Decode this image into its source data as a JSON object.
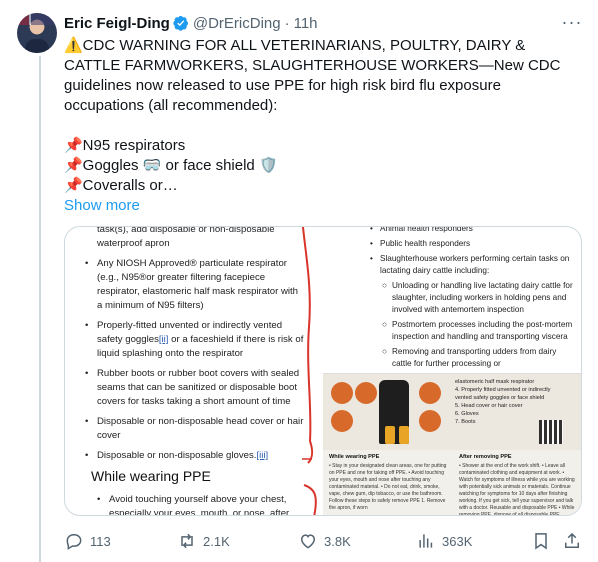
{
  "tweet": {
    "author_name": "Eric Feigl-Ding",
    "handle": "@DrEricDing",
    "separator": "·",
    "time": "11h",
    "more_label": "···",
    "text_para1": "⚠️CDC WARNING FOR ALL VETERINARIANS, POULTRY, DAIRY & CATTLE FARMWORKERS, SLAUGHTERHOUSE WORKERS—New CDC guidelines now released to use PPE for high risk bird flu exposure occupations (all recommended):",
    "line1": "📌N95 respirators",
    "line2": "📌Goggles 🥽 or face shield 🛡️",
    "line3": "📌Coveralls or…",
    "show_more": "Show more"
  },
  "media": {
    "left_top_fragment": "task(s), add disposable or non-disposable waterproof apron",
    "left_items": [
      "Any NIOSH Approved® particulate respirator (e.g., N95®or greater filtering facepiece respirator, elastomeric half mask respirator with a minimum of N95 filters)",
      "Properly-fitted unvented or indirectly vented safety goggles",
      "Rubber boots or rubber boot covers with sealed seams that can be sanitized or disposable boot covers for tasks taking a short amount of time",
      "Disposable or non-disposable head cover or hair cover",
      "Disposable or non-disposable gloves."
    ],
    "goggles_ref": "[ii]",
    "goggles_tail": " or a faceshield if there is risk of liquid splashing onto the respirator",
    "gloves_ref": "[iii]",
    "heading": "While wearing PPE",
    "wearing_item": "Avoid touching yourself above your chest, especially your eyes, mouth, or nose, after",
    "right_top_fragment": "Animal health responders",
    "right_items": [
      "Public health responders",
      "Slaughterhouse workers performing certain tasks on lactating dairy cattle including:"
    ],
    "right_sub": [
      "Unloading or handling live lactating dairy cattle for slaughter, including workers in holding pens and involved with antemortem inspection",
      "Postmortem processes including the post-mortem inspection and handling and transporting viscera",
      "Removing and transporting udders from dairy cattle for further processing or"
    ],
    "poster_list": [
      "elastomeric half mask respirator",
      "4. Properly fitted unvented or indirectly vented safety goggles or face shield",
      "5. Head cover or hair cover",
      "6. Gloves",
      "7. Boots"
    ],
    "poster_wearing_title": "While wearing PPE",
    "poster_wearing_text": "• Stay in your designated clean areas, one for putting on PPE and one for taking off PPE. • Avoid touching your eyes, mouth and nose after touching any contaminated material. • Do not eat, drink, smoke, vape, chew gum, dip tobacco, or use the bathroom. Follow these steps to safely remove PPE 1. Remove the apron, if worn",
    "poster_removing_title": "After removing PPE",
    "poster_removing_text": "• Shower at the end of the work shift. • Leave all contaminated clothing and equipment at work. • Watch for symptoms of illness while you are working with potentially sick animals or materials. Continue watching for symptoms for 10 days after finishing working. If you get sick, tell your supervisor and talk with a doctor. Reusable and disposable PPE • While removing PPE, dispose of all disposable PPE"
  },
  "actions": {
    "replies": "113",
    "reposts": "2.1K",
    "likes": "3.8K",
    "views": "363K"
  },
  "colors": {
    "link": "#1d9bf0",
    "muted": "#536471",
    "verified": "#1d9bf0",
    "annotation_red": "#d8342a",
    "poster_orange": "#d76a2a"
  }
}
